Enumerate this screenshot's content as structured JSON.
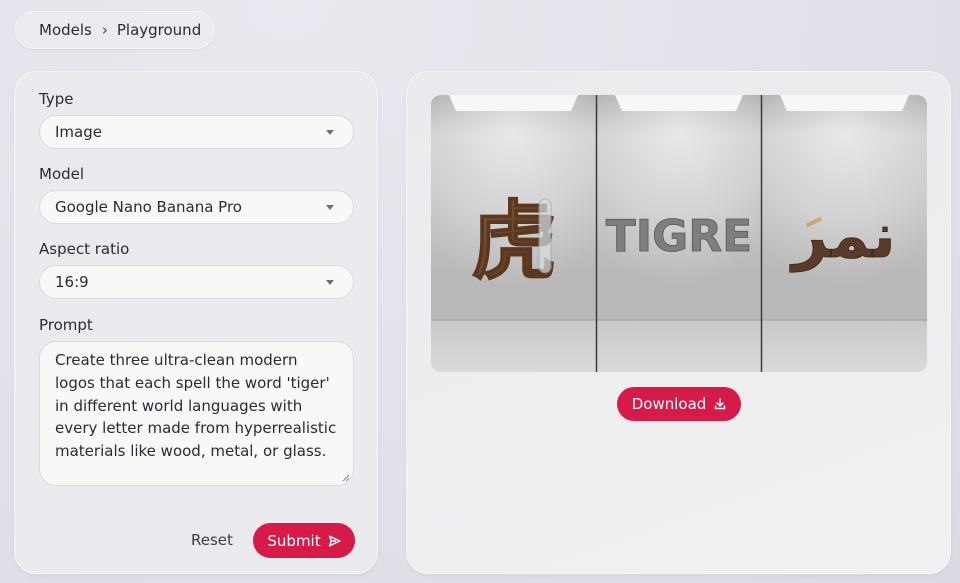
{
  "breadcrumb": {
    "root": "Models",
    "separator": "›",
    "current": "Playground"
  },
  "form": {
    "type_label": "Type",
    "type_value": "Image",
    "model_label": "Model",
    "model_value": "Google Nano Banana Pro",
    "aspect_label": "Aspect ratio",
    "aspect_value": "16:9",
    "prompt_label": "Prompt",
    "prompt_value": "Create three ultra-clean modern logos that each spell the word 'tiger' in different world languages with every letter made from hyperrealistic materials like wood, metal, or glass.",
    "reset_label": "Reset",
    "submit_label": "Submit"
  },
  "result": {
    "panel_texts": [
      "虎",
      "TIGRE",
      "نمر"
    ],
    "download_label": "Download"
  },
  "icons": {
    "breadcrumb_separator": "chevron-right-icon",
    "select_caret": "caret-down-icon",
    "submit": "send-icon",
    "download": "download-icon"
  },
  "colors": {
    "accent": "#d71b48",
    "panel_bg": "#ebeaee",
    "page_bg": "#e2e0e8",
    "input_bg": "#f8f8f9"
  }
}
